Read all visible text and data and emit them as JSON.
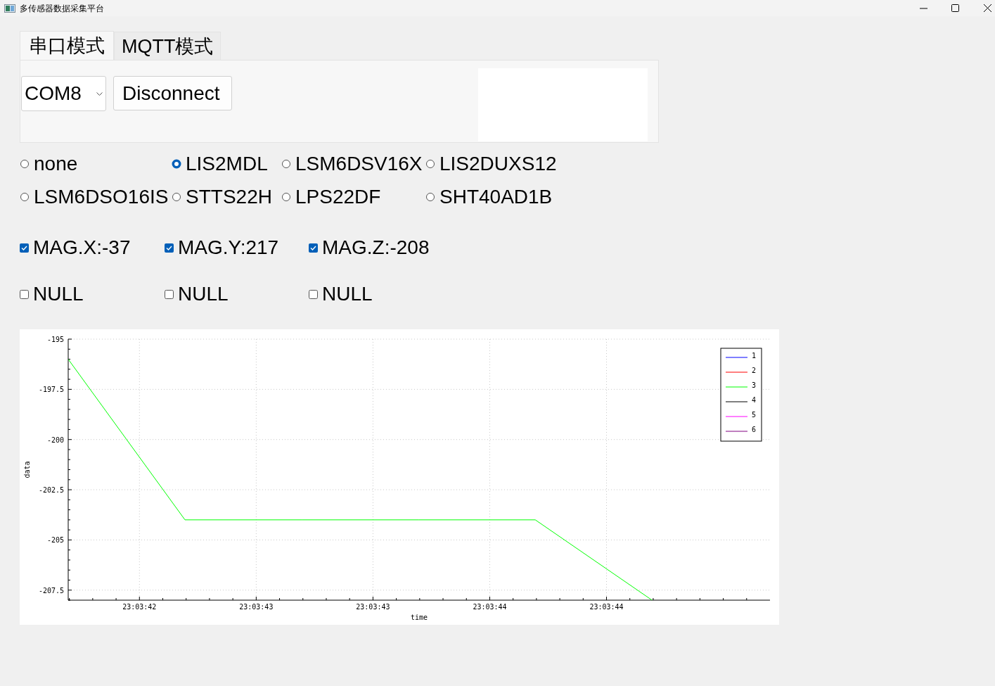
{
  "window": {
    "title": "多传感器数据采集平台"
  },
  "tabs": [
    {
      "label": "串口模式",
      "selected": true
    },
    {
      "label": "MQTT模式",
      "selected": false
    }
  ],
  "port": {
    "value": "COM8"
  },
  "connect_button": "Disconnect",
  "sensors": [
    {
      "label": "none",
      "selected": false
    },
    {
      "label": "LIS2MDL",
      "selected": true
    },
    {
      "label": "LSM6DSV16X",
      "selected": false
    },
    {
      "label": "LIS2DUXS12",
      "selected": false
    },
    {
      "label": "LSM6DSO16IS",
      "selected": false
    },
    {
      "label": "STTS22H",
      "selected": false
    },
    {
      "label": "LPS22DF",
      "selected": false
    },
    {
      "label": "SHT40AD1B",
      "selected": false
    }
  ],
  "channels": [
    {
      "label": "MAG.X:-37",
      "checked": true
    },
    {
      "label": "MAG.Y:217",
      "checked": true
    },
    {
      "label": "MAG.Z:-208",
      "checked": true
    },
    {
      "label": "NULL",
      "checked": false
    },
    {
      "label": "NULL",
      "checked": false
    },
    {
      "label": "NULL",
      "checked": false
    }
  ],
  "chart_data": {
    "type": "line",
    "xlabel": "time",
    "ylabel": "data",
    "x": [
      83021.895,
      83022.395,
      83022.895,
      83023.395,
      83023.895,
      83024.395
    ],
    "grid": true,
    "series": [
      {
        "name": "1",
        "color": "#0000ff",
        "values": [
          null,
          null,
          null,
          null,
          null,
          null
        ]
      },
      {
        "name": "2",
        "color": "#ff0000",
        "values": [
          null,
          null,
          null,
          null,
          null,
          null
        ]
      },
      {
        "name": "3",
        "color": "#00ff00",
        "values": [
          -196,
          -204,
          -204,
          -204,
          -204,
          -208
        ]
      },
      {
        "name": "4",
        "color": "#000000",
        "values": [
          null,
          null,
          null,
          null,
          null,
          null
        ]
      },
      {
        "name": "5",
        "color": "#ff00ff",
        "values": [
          null,
          null,
          null,
          null,
          null,
          null
        ]
      },
      {
        "name": "6",
        "color": "#800080",
        "values": [
          null,
          null,
          null,
          null,
          null,
          null
        ]
      }
    ],
    "xlim": [
      83021.895,
      83024.9
    ],
    "ylim": [
      -208,
      -195
    ],
    "xticks": [
      {
        "value": 83022.2,
        "label": "23:03:42"
      },
      {
        "value": 83022.7,
        "label": "23:03:43"
      },
      {
        "value": 83023.2,
        "label": "23:03:43"
      },
      {
        "value": 83023.7,
        "label": "23:03:44"
      },
      {
        "value": 83024.2,
        "label": "23:03:44"
      }
    ],
    "yticks": [
      -195,
      -197.5,
      -200,
      -202.5,
      -205,
      -207.5
    ]
  }
}
